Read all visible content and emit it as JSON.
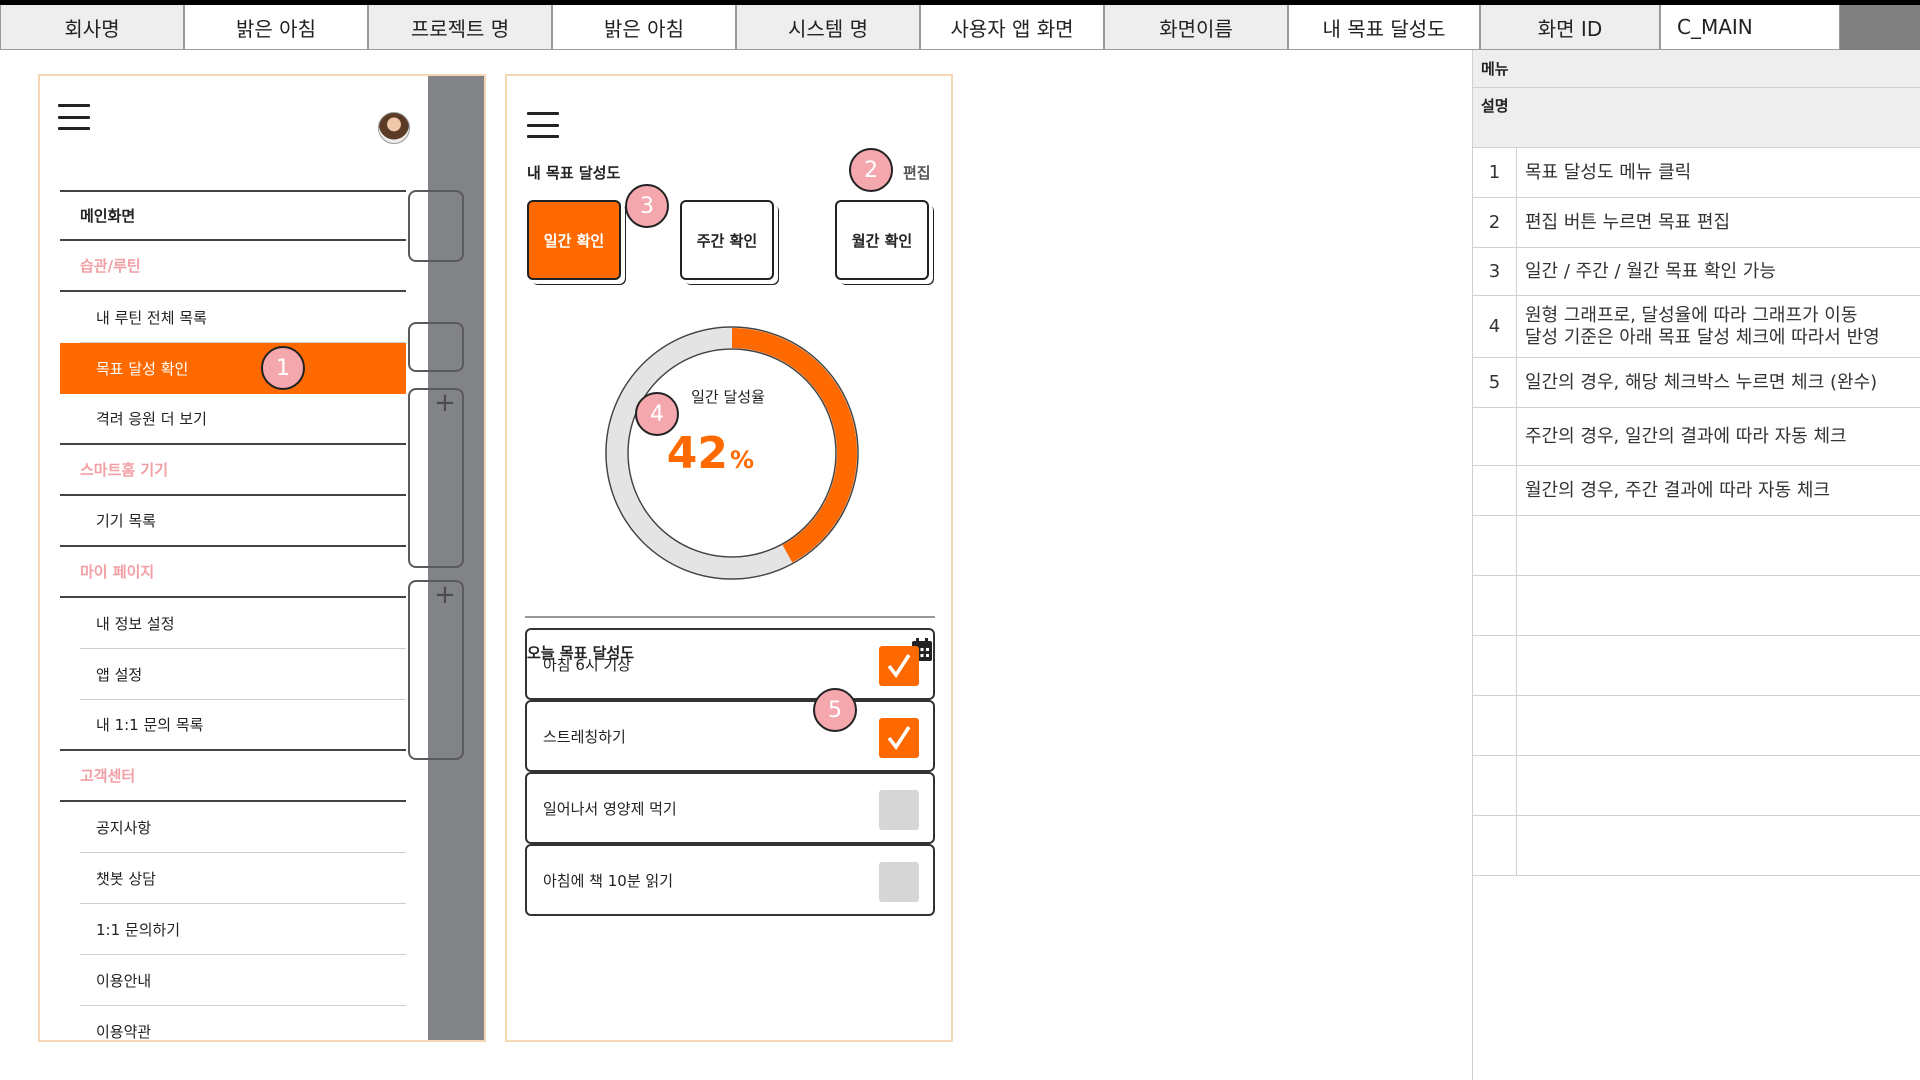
{
  "header": {
    "cells": [
      {
        "text": "회사명",
        "kind": "label",
        "w": 184
      },
      {
        "text": "밝은 아침",
        "kind": "value",
        "w": 184
      },
      {
        "text": "프로젝트 명",
        "kind": "label",
        "w": 184
      },
      {
        "text": "밝은 아침",
        "kind": "value",
        "w": 184
      },
      {
        "text": "시스템 명",
        "kind": "label",
        "w": 184
      },
      {
        "text": "사용자 앱 화면",
        "kind": "value",
        "w": 184
      },
      {
        "text": "화면이름",
        "kind": "label",
        "w": 184
      },
      {
        "text": "내 목표 달성도",
        "kind": "value",
        "w": 192
      },
      {
        "text": "화면 ID",
        "kind": "label",
        "w": 180
      },
      {
        "text": "C_MAIN",
        "kind": "value",
        "w": 180
      }
    ]
  },
  "description": {
    "menu_label": "메뉴",
    "desc_label": "설명",
    "rows": [
      {
        "num": "1",
        "lines": [
          "목표 달성도 메뉴 클릭"
        ]
      },
      {
        "num": "2",
        "lines": [
          "편집 버튼 누르면 목표 편집"
        ]
      },
      {
        "num": "3",
        "lines": [
          "일간 / 주간 / 월간 목표 확인 가능"
        ]
      },
      {
        "num": "4",
        "lines": [
          "원형 그래프로, 달성율에 따라 그래프가 이동",
          "달성 기준은 아래 목표 달성 체크에 따라서 반영"
        ]
      },
      {
        "num": "5",
        "lines": [
          "일간의 경우, 해당 체크박스 누르면 체크 (완수)"
        ]
      },
      {
        "num": "",
        "lines": [
          "주간의 경우, 일간의 결과에 따라 자동 체크"
        ]
      },
      {
        "num": "",
        "lines": [
          "월간의 경우, 주간 결과에 따라 자동 체크"
        ]
      },
      {
        "num": "",
        "lines": [
          ""
        ]
      },
      {
        "num": "",
        "lines": [
          ""
        ]
      },
      {
        "num": "",
        "lines": [
          ""
        ]
      },
      {
        "num": "",
        "lines": [
          ""
        ]
      },
      {
        "num": "",
        "lines": [
          ""
        ]
      },
      {
        "num": "",
        "lines": [
          ""
        ]
      }
    ]
  },
  "drawer": {
    "main": "메인화면",
    "items": [
      {
        "text": "습관/루틴",
        "type": "sec"
      },
      {
        "text": "내 루틴 전체 목록",
        "type": "sub",
        "inner": true
      },
      {
        "text": "목표 달성 확인",
        "type": "sub",
        "active": true
      },
      {
        "text": "격려 응원 더 보기",
        "type": "sub",
        "end": true
      },
      {
        "text": "스마트홈 기기",
        "type": "sec"
      },
      {
        "text": "기기 목록",
        "type": "sub",
        "end": true
      },
      {
        "text": "마이 페이지",
        "type": "sec"
      },
      {
        "text": "내 정보 설정",
        "type": "sub",
        "inner": true
      },
      {
        "text": "앱 설정",
        "type": "sub",
        "inner": true
      },
      {
        "text": "내 1:1 문의 목록",
        "type": "sub",
        "end": true
      },
      {
        "text": "고객센터",
        "type": "sec"
      },
      {
        "text": "공지사항",
        "type": "sub",
        "inner": true
      },
      {
        "text": "챗봇 상담",
        "type": "sub",
        "inner": true
      },
      {
        "text": "1:1 문의하기",
        "type": "sub",
        "inner": true
      },
      {
        "text": "이용안내",
        "type": "sub",
        "inner": true
      },
      {
        "text": "이용약관",
        "type": "sub",
        "inner": true
      }
    ]
  },
  "goal": {
    "title": "내 목표 달성도",
    "edit": "편집",
    "tabs": [
      "일간 확인",
      "주간 확인",
      "월간 확인"
    ],
    "active_tab": 0,
    "gauge_label": "일간 달성율",
    "rate_value": "42",
    "rate_unit": "%",
    "rate": 0.42,
    "today_title": "오늘 목표 달성도",
    "tasks": [
      {
        "text": "아침 6시 기상",
        "checked": true
      },
      {
        "text": "스트레칭하기",
        "checked": true
      },
      {
        "text": "일어나서 영양제 먹기",
        "checked": false
      },
      {
        "text": "아침에 책 10분 읽기",
        "checked": false
      }
    ]
  },
  "markers": [
    "1",
    "2",
    "3",
    "4",
    "5"
  ],
  "colors": {
    "accent": "#ff6a00",
    "marker": "#f4a7ad",
    "section": "#f2a0a5",
    "track": "#e4e4e4"
  }
}
